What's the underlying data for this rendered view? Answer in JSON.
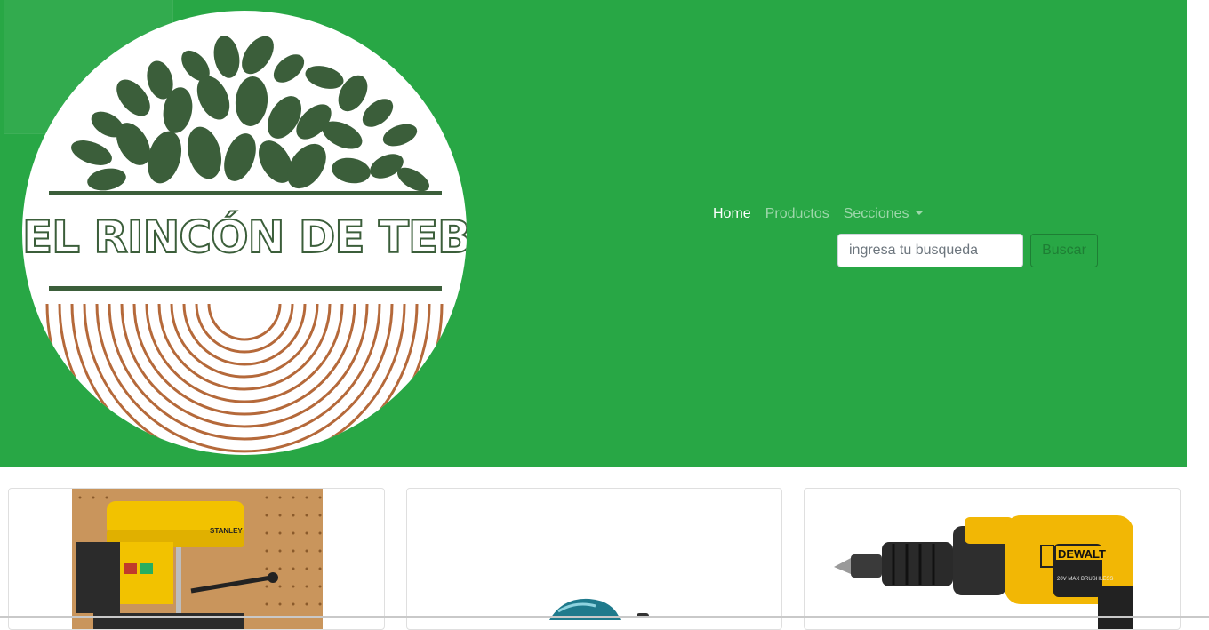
{
  "brand": {
    "logo_text": "EL RINCÓN DE TEBI",
    "colors": {
      "navbar": "#28a745",
      "leaf": "#3b5e3a",
      "rings": "#b5693a"
    }
  },
  "nav": {
    "items": [
      {
        "label": "Home",
        "active": true
      },
      {
        "label": "Productos",
        "active": false
      },
      {
        "label": "Secciones",
        "active": false,
        "dropdown": true
      }
    ]
  },
  "search": {
    "placeholder": "ingresa tu busqueda",
    "button_label": "Buscar"
  },
  "products": [
    {
      "image": "stanley-drill-press-photo",
      "brand_label": "STANLEY"
    },
    {
      "image": "teal-power-tool-photo"
    },
    {
      "image": "dewalt-cordless-drill-photo",
      "brand_label": "DEWALT",
      "sub_label": "20V MAX BRUSHLESS"
    }
  ]
}
